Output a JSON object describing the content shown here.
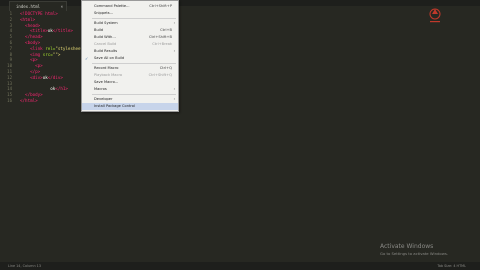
{
  "tab": {
    "label": "index.html",
    "close": "×"
  },
  "gutter": [
    "1",
    "2",
    "3",
    "4",
    "5",
    "6",
    "7",
    "8",
    "9",
    "10",
    "11",
    "12",
    "13",
    "14",
    "15",
    "16"
  ],
  "code_lines": [
    [
      {
        "c": "tag",
        "t": "<!DOCTYPE html>"
      }
    ],
    [
      {
        "c": "tag",
        "t": "<html>"
      }
    ],
    [
      {
        "c": "tag",
        "t": "  <head>"
      }
    ],
    [
      {
        "c": "tag",
        "t": "    <title>"
      },
      {
        "c": "txt",
        "t": "ok"
      },
      {
        "c": "tag",
        "t": "</title>"
      }
    ],
    [
      {
        "c": "tag",
        "t": "  </head>"
      }
    ],
    [
      {
        "c": "tag",
        "t": "  <body>"
      }
    ],
    [
      {
        "c": "tag",
        "t": "    <link "
      },
      {
        "c": "attr",
        "t": "rel="
      },
      {
        "c": "str",
        "t": "\"stylesheet\""
      }
    ],
    [
      {
        "c": "tag",
        "t": "    <img "
      },
      {
        "c": "attr",
        "t": "src="
      },
      {
        "c": "str",
        "t": "\"\">"
      }
    ],
    [
      {
        "c": "tag",
        "t": "    <p>"
      }
    ],
    [
      {
        "c": "tag",
        "t": "      <p>"
      }
    ],
    [
      {
        "c": "tag",
        "t": "    </p>"
      }
    ],
    [
      {
        "c": "tag",
        "t": "    <div>"
      },
      {
        "c": "txt",
        "t": "ok"
      },
      {
        "c": "tag",
        "t": "</div>"
      }
    ],
    [
      {
        "c": "txt",
        "t": ""
      }
    ],
    [
      {
        "c": "txt",
        "t": "            ok"
      },
      {
        "c": "tag",
        "t": "</h1>"
      }
    ],
    [
      {
        "c": "tag",
        "t": "  </body>"
      }
    ],
    [
      {
        "c": "tag",
        "t": "</html>"
      }
    ]
  ],
  "menu": {
    "items": [
      {
        "label": "Command Palette...",
        "shortcut": "Ctrl+Shift+P",
        "disabled": false,
        "arrow": false,
        "check": false
      },
      {
        "label": "Snippets...",
        "shortcut": "",
        "disabled": false,
        "arrow": false,
        "check": false
      },
      {
        "sep": true
      },
      {
        "label": "Build System",
        "shortcut": "",
        "disabled": false,
        "arrow": true,
        "check": false
      },
      {
        "label": "Build",
        "shortcut": "Ctrl+B",
        "disabled": false,
        "arrow": false,
        "check": false
      },
      {
        "label": "Build With...",
        "shortcut": "Ctrl+Shift+B",
        "disabled": false,
        "arrow": false,
        "check": false
      },
      {
        "label": "Cancel Build",
        "shortcut": "Ctrl+Break",
        "disabled": true,
        "arrow": false,
        "check": false
      },
      {
        "label": "Build Results",
        "shortcut": "",
        "disabled": false,
        "arrow": true,
        "check": false
      },
      {
        "label": "Save All on Build",
        "shortcut": "",
        "disabled": false,
        "arrow": false,
        "check": true
      },
      {
        "sep": true
      },
      {
        "label": "Record Macro",
        "shortcut": "Ctrl+Q",
        "disabled": false,
        "arrow": false,
        "check": false
      },
      {
        "label": "Playback Macro",
        "shortcut": "Ctrl+Shift+Q",
        "disabled": true,
        "arrow": false,
        "check": false
      },
      {
        "label": "Save Macro...",
        "shortcut": "",
        "disabled": false,
        "arrow": false,
        "check": false
      },
      {
        "label": "Macros",
        "shortcut": "",
        "disabled": false,
        "arrow": true,
        "check": false
      },
      {
        "sep": true
      },
      {
        "label": "Developer",
        "shortcut": "",
        "disabled": false,
        "arrow": true,
        "check": false
      },
      {
        "label": "Install Package Control",
        "shortcut": "",
        "disabled": false,
        "arrow": false,
        "check": false,
        "highlight": true
      }
    ]
  },
  "watermark": {
    "line1": "Activate Windows",
    "line2": "Go to Settings to activate Windows."
  },
  "status": {
    "left": "Line 14, Column 13",
    "right": "Tab Size: 4    HTML"
  },
  "colors": {
    "editor_bg": "#272822",
    "menu_bg": "#f1f1ee",
    "highlight": "#c7d4ea",
    "logo": "#c0392b"
  }
}
